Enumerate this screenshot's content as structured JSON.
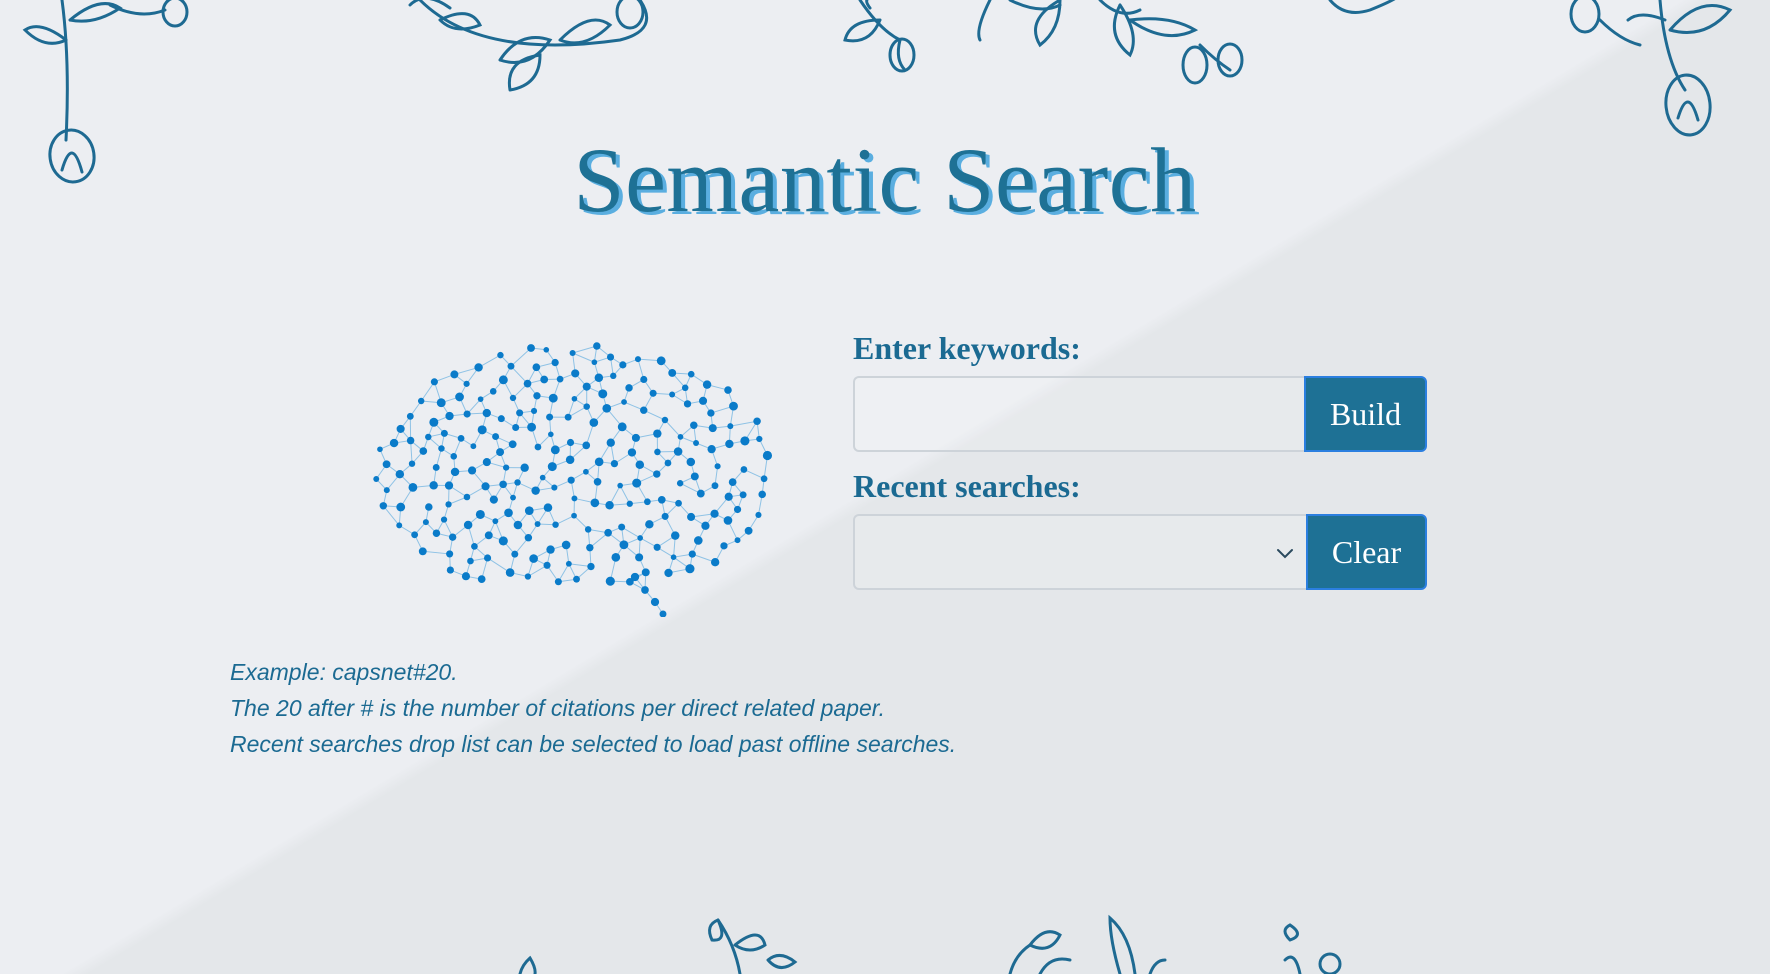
{
  "page": {
    "title": "Semantic Search"
  },
  "form": {
    "keywords_label": "Enter keywords:",
    "keywords_value": "",
    "build_label": "Build",
    "recent_label": "Recent searches:",
    "recent_selected": "",
    "clear_label": "Clear"
  },
  "help": {
    "lines": [
      "Example: capsnet#20.",
      "The 20 after # is the number of citations per direct related paper.",
      "Recent searches drop list can be selected to load past offline searches."
    ]
  },
  "icons": {
    "brain": "brain-network-icon",
    "dropdown": "chevron-down-icon",
    "decor": "floral-vine-icon"
  },
  "colors": {
    "primary": "#1e7195",
    "title_shadow": "#5aaee0",
    "button_border": "#2b7fe0",
    "brain_nodes": "#0a7bc9",
    "background_light": "#eceef2",
    "background_dark": "#e4e7ea"
  }
}
